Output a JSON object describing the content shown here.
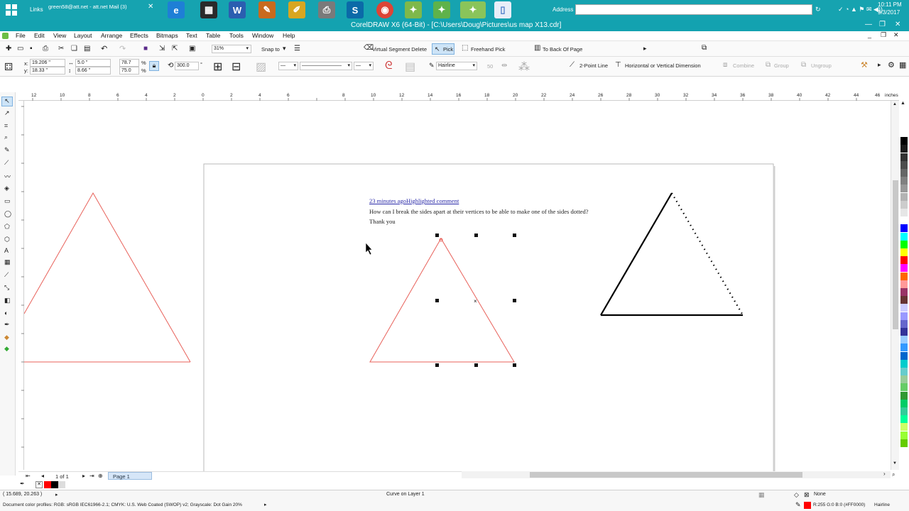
{
  "taskbar": {
    "links_label": "Links",
    "mail_label": "green58@att.net - att.net Mail (3)",
    "address_label": "Address",
    "time": "10:11 PM",
    "date": "9/3/2017"
  },
  "window": {
    "title": "CorelDRAW X6 (64-Bit) - [C:\\Users\\Doug\\Pictures\\us map X13.cdr]"
  },
  "menu": [
    "File",
    "Edit",
    "View",
    "Layout",
    "Arrange",
    "Effects",
    "Bitmaps",
    "Text",
    "Table",
    "Tools",
    "Window",
    "Help"
  ],
  "toolbar1": {
    "zoom": "31%",
    "snap_to": "Snap to",
    "virtual_segment_delete": "Virtual Segment Delete",
    "pick": "Pick",
    "freehand_pick": "Freehand Pick",
    "to_back_of_page": "To Back Of Page"
  },
  "property_bar": {
    "x": "19.206 \"",
    "y": "18.33 \"",
    "width": "5.0 \"",
    "height": "8.66 \"",
    "scale_x": "78.7",
    "scale_y": "75.0",
    "percent": "%",
    "angle": "300.0",
    "degree": "°",
    "outline_width": "Hairline",
    "fifty": "50",
    "two_point_line": "2-Point Line",
    "horiz_vert_dimension": "Horizontal or Vertical Dimension",
    "combine": "Combine",
    "group": "Group",
    "ungroup": "Ungroup"
  },
  "ruler": {
    "top_labels": [
      "12",
      "10",
      "8",
      "6",
      "4",
      "2",
      "0",
      "2",
      "4",
      "6",
      "8",
      "10",
      "12",
      "14",
      "16",
      "18",
      "20",
      "22",
      "24",
      "26",
      "28",
      "30",
      "32",
      "34",
      "36",
      "38",
      "40",
      "42",
      "44",
      "46"
    ],
    "units": "inches"
  },
  "canvas": {
    "comment_link": "23 minutes agoHighlighted comment",
    "question": "How can I break the sides apart at their vertices to be able to make one of the sides dotted?",
    "thanks": "Thank you"
  },
  "pagebar": {
    "page_count": "1 of 1",
    "page_tab": "Page 1"
  },
  "status": {
    "coordinates": "( 15.689, 20.263 )",
    "object_info": "Curve on Layer 1",
    "fill_none": "None",
    "color_profiles": "Document color profiles: RGB: sRGB IEC61966-2.1; CMYK: U.S. Web Coated (SWOP) v2; Grayscale: Dot Gain 20%",
    "outline_color": "R:255 G:0 B:0 (#FF0000)",
    "outline_width": "Hairline"
  },
  "colors": {
    "taskbar": "#16a3b0",
    "selection_red": "#e8615a",
    "link_blue": "#2a2aa8"
  },
  "palette": [
    "#ffffff",
    "#000000",
    "#1a1a1a",
    "#333333",
    "#4d4d4d",
    "#666666",
    "#808080",
    "#999999",
    "#b3b3b3",
    "#cccccc",
    "#e6e6e6",
    "#ffffff",
    "#0000ff",
    "#00ffff",
    "#00ff00",
    "#ffff00",
    "#ff0000",
    "#ff00ff",
    "#ff6600",
    "#ff9999",
    "#993366",
    "#663333",
    "#ccccff",
    "#9999ff",
    "#6666cc",
    "#333399",
    "#99ccff",
    "#3399ff",
    "#0066cc",
    "#00cccc",
    "#66cccc",
    "#99cc99",
    "#66cc66",
    "#339933",
    "#00cc66",
    "#33cc99",
    "#00ff99",
    "#ccff66",
    "#99ff33",
    "#66cc00"
  ]
}
